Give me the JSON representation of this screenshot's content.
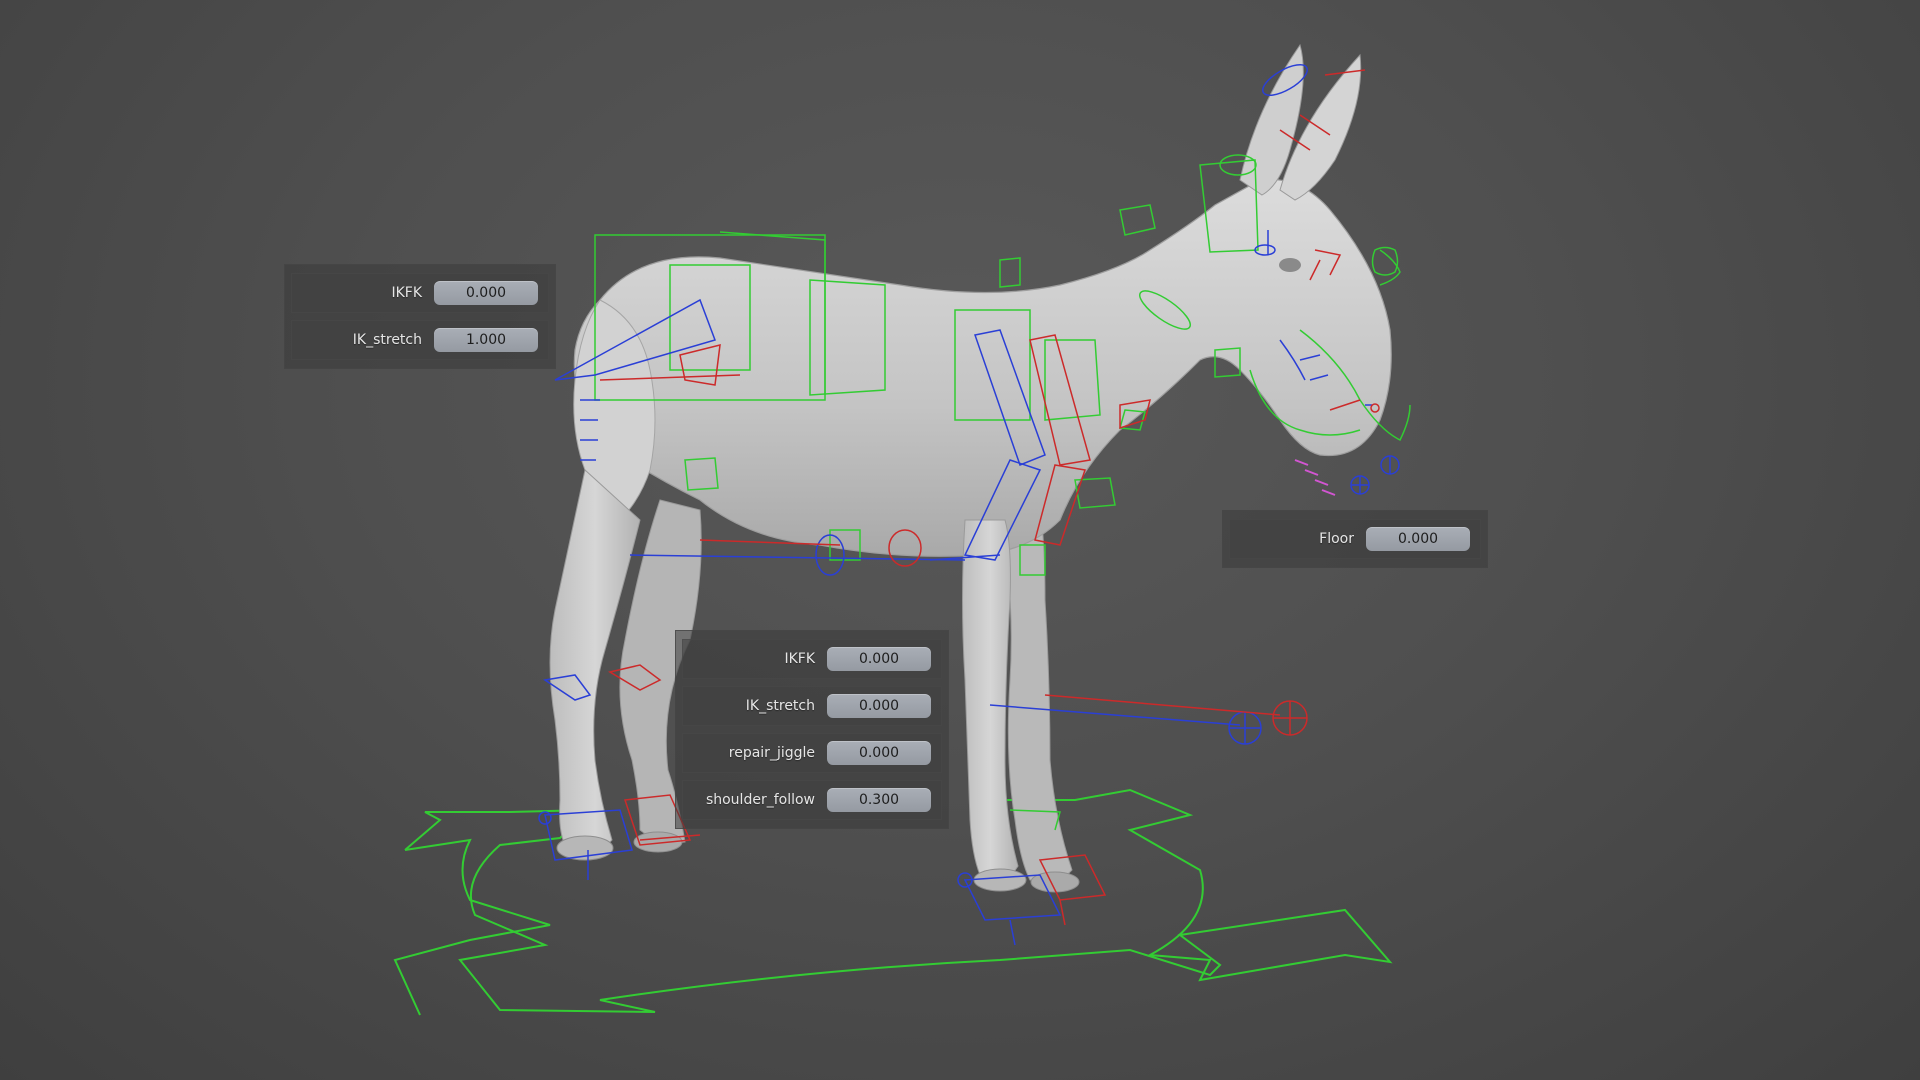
{
  "panels": {
    "top_left": {
      "rows": [
        {
          "label": "IKFK",
          "value": "0.000"
        },
        {
          "label": "IK_stretch",
          "value": "1.000"
        }
      ]
    },
    "floor": {
      "rows": [
        {
          "label": "Floor",
          "value": "0.000"
        }
      ]
    },
    "center": {
      "rows": [
        {
          "label": "IKFK",
          "value": "0.000"
        },
        {
          "label": "IK_stretch",
          "value": "0.000"
        },
        {
          "label": "repair_jiggle",
          "value": "0.000"
        },
        {
          "label": "shoulder_follow",
          "value": "0.300"
        }
      ]
    }
  },
  "colors": {
    "viewport_bg": "#4f4f4f",
    "mesh": "#c9c9c9",
    "control_green": "#33cc33",
    "control_blue": "#2a3fd6",
    "control_red": "#cc2a2a",
    "control_magenta": "#d255d2"
  }
}
